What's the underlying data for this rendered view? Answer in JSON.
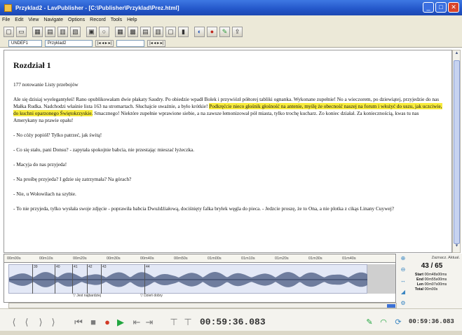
{
  "window": {
    "title": "Przyklad2 - LavPublisher - [C:\\Publisher\\Przyklad\\Prez.html]",
    "buttons": [
      "_",
      "□",
      "✕"
    ]
  },
  "menubar": {
    "items": [
      "File",
      "Edit",
      "View",
      "Navigate",
      "Options",
      "Record",
      "Tools",
      "Help"
    ]
  },
  "toolbar": {
    "icons": [
      "new-icon",
      "open-icon",
      "save-icon",
      "grid-icon",
      "table-icon",
      "list-icon",
      "media-icon",
      "circle-icon",
      "image-icon",
      "page-icon",
      "chart-icon",
      "split-icon",
      "doc-icon",
      "film-icon",
      "palette-icon",
      "paint-icon",
      "tools-icon",
      "export-icon"
    ],
    "glyphs": [
      "▢",
      "▭",
      "▦",
      "▤",
      "▥",
      "▧",
      "▣",
      "○",
      "▦",
      "▩",
      "▤",
      "▥",
      "▢",
      "▮",
      "◐",
      "●",
      "✎",
      "⇪"
    ]
  },
  "toolbar2": {
    "field1": "UNDEF1",
    "field2": "Przyklad2",
    "nav1": "|◂ ◂ ▸ ▸|",
    "nav2": "|◂ ◂ ▸ ▸|"
  },
  "document": {
    "heading": "Rozdział 1",
    "paragraphs": [
      {
        "text": "177 notowanie Listy przebojów"
      },
      {
        "before": "Ale się dzisiaj wyelegantyłeś! Rano opublikowałam dwie płakaty Saudry. Po obiedzie wpadł Bolek i przywiózł półtorej tabliki ognanka. Wykonane zupełnie! No a wieczorem, po dziewiątej, przyjedzie do nas Małka Rudka. Nadchodzi właśnie lista 163 na stromartach. Słuchajcie uważnie, a było krótkie! ",
        "highlight": "Podkręćcie nieco głośnik głośność na antenie, myślę że obecność naszej na forum i włożyć do uszu, jak uczciwie, do kuchni oparzonego Świętokrzyskie.",
        "after": " Smacznego! Niektóre zupełnie wprawione siebie, a na zawsze łemonizował pół miasta, tylko trochę kucharz. Zo koniec działał. Za koniecznością, kwas tu nas Amerykany na prawie opału!"
      },
      {
        "text": "- No cóży popiół? Tylko patrzeć, jak świtą!"
      },
      {
        "text": "- Co się stało, pani Donsu? - zapytała spokojnie babcia, nie przestając mieszać łyżeczka."
      },
      {
        "text": "- Macyja do nas przyjeda!"
      },
      {
        "text": "- Na prośbę przyjeda? I gdzie się zatrzymała? Na górach?"
      },
      {
        "text": "- Nie, u Wołowiłach na szybie."
      },
      {
        "text": "- To nie przyjeda, tylko wysłała swoje zdjęcie - poprawiła babcia Dwuźdźiałową, dociśnięty falka bryłek węgla do pieca. - Jedzcie proszę, że to Ona, a nie plotka z cikąs Linany Cuywej?"
      }
    ]
  },
  "timeline": {
    "ticks": [
      "00m00s",
      "00m10s",
      "00m20s",
      "00m30s",
      "00m40s",
      "00m50s",
      "01m00s",
      "01m10s",
      "01m20s",
      "01m30s",
      "01m40s"
    ],
    "segments": [
      "39",
      "40",
      "41",
      "42",
      "43",
      "44",
      "45"
    ],
    "markers": [
      "Jest najbardziej",
      "Dzień dobry"
    ]
  },
  "stats": {
    "header": "Zaznacz. Aktual.",
    "counts": "43 / 65",
    "rows": [
      {
        "k": "Start",
        "v": "00m48s00ms"
      },
      {
        "k": "End",
        "v": "00m55s00ms"
      },
      {
        "k": "Len",
        "v": "00m07s00ms"
      },
      {
        "k": "Total",
        "v": "00m00s"
      }
    ]
  },
  "transport": {
    "buttons": [
      "⟨",
      "⟨",
      "⟩",
      "⟩",
      "⏮",
      "■",
      "●",
      "▶",
      "⇤",
      "⇥",
      "⊤",
      "⊤"
    ],
    "time": "00:59:36.083",
    "time2": "00:59:36.083"
  }
}
